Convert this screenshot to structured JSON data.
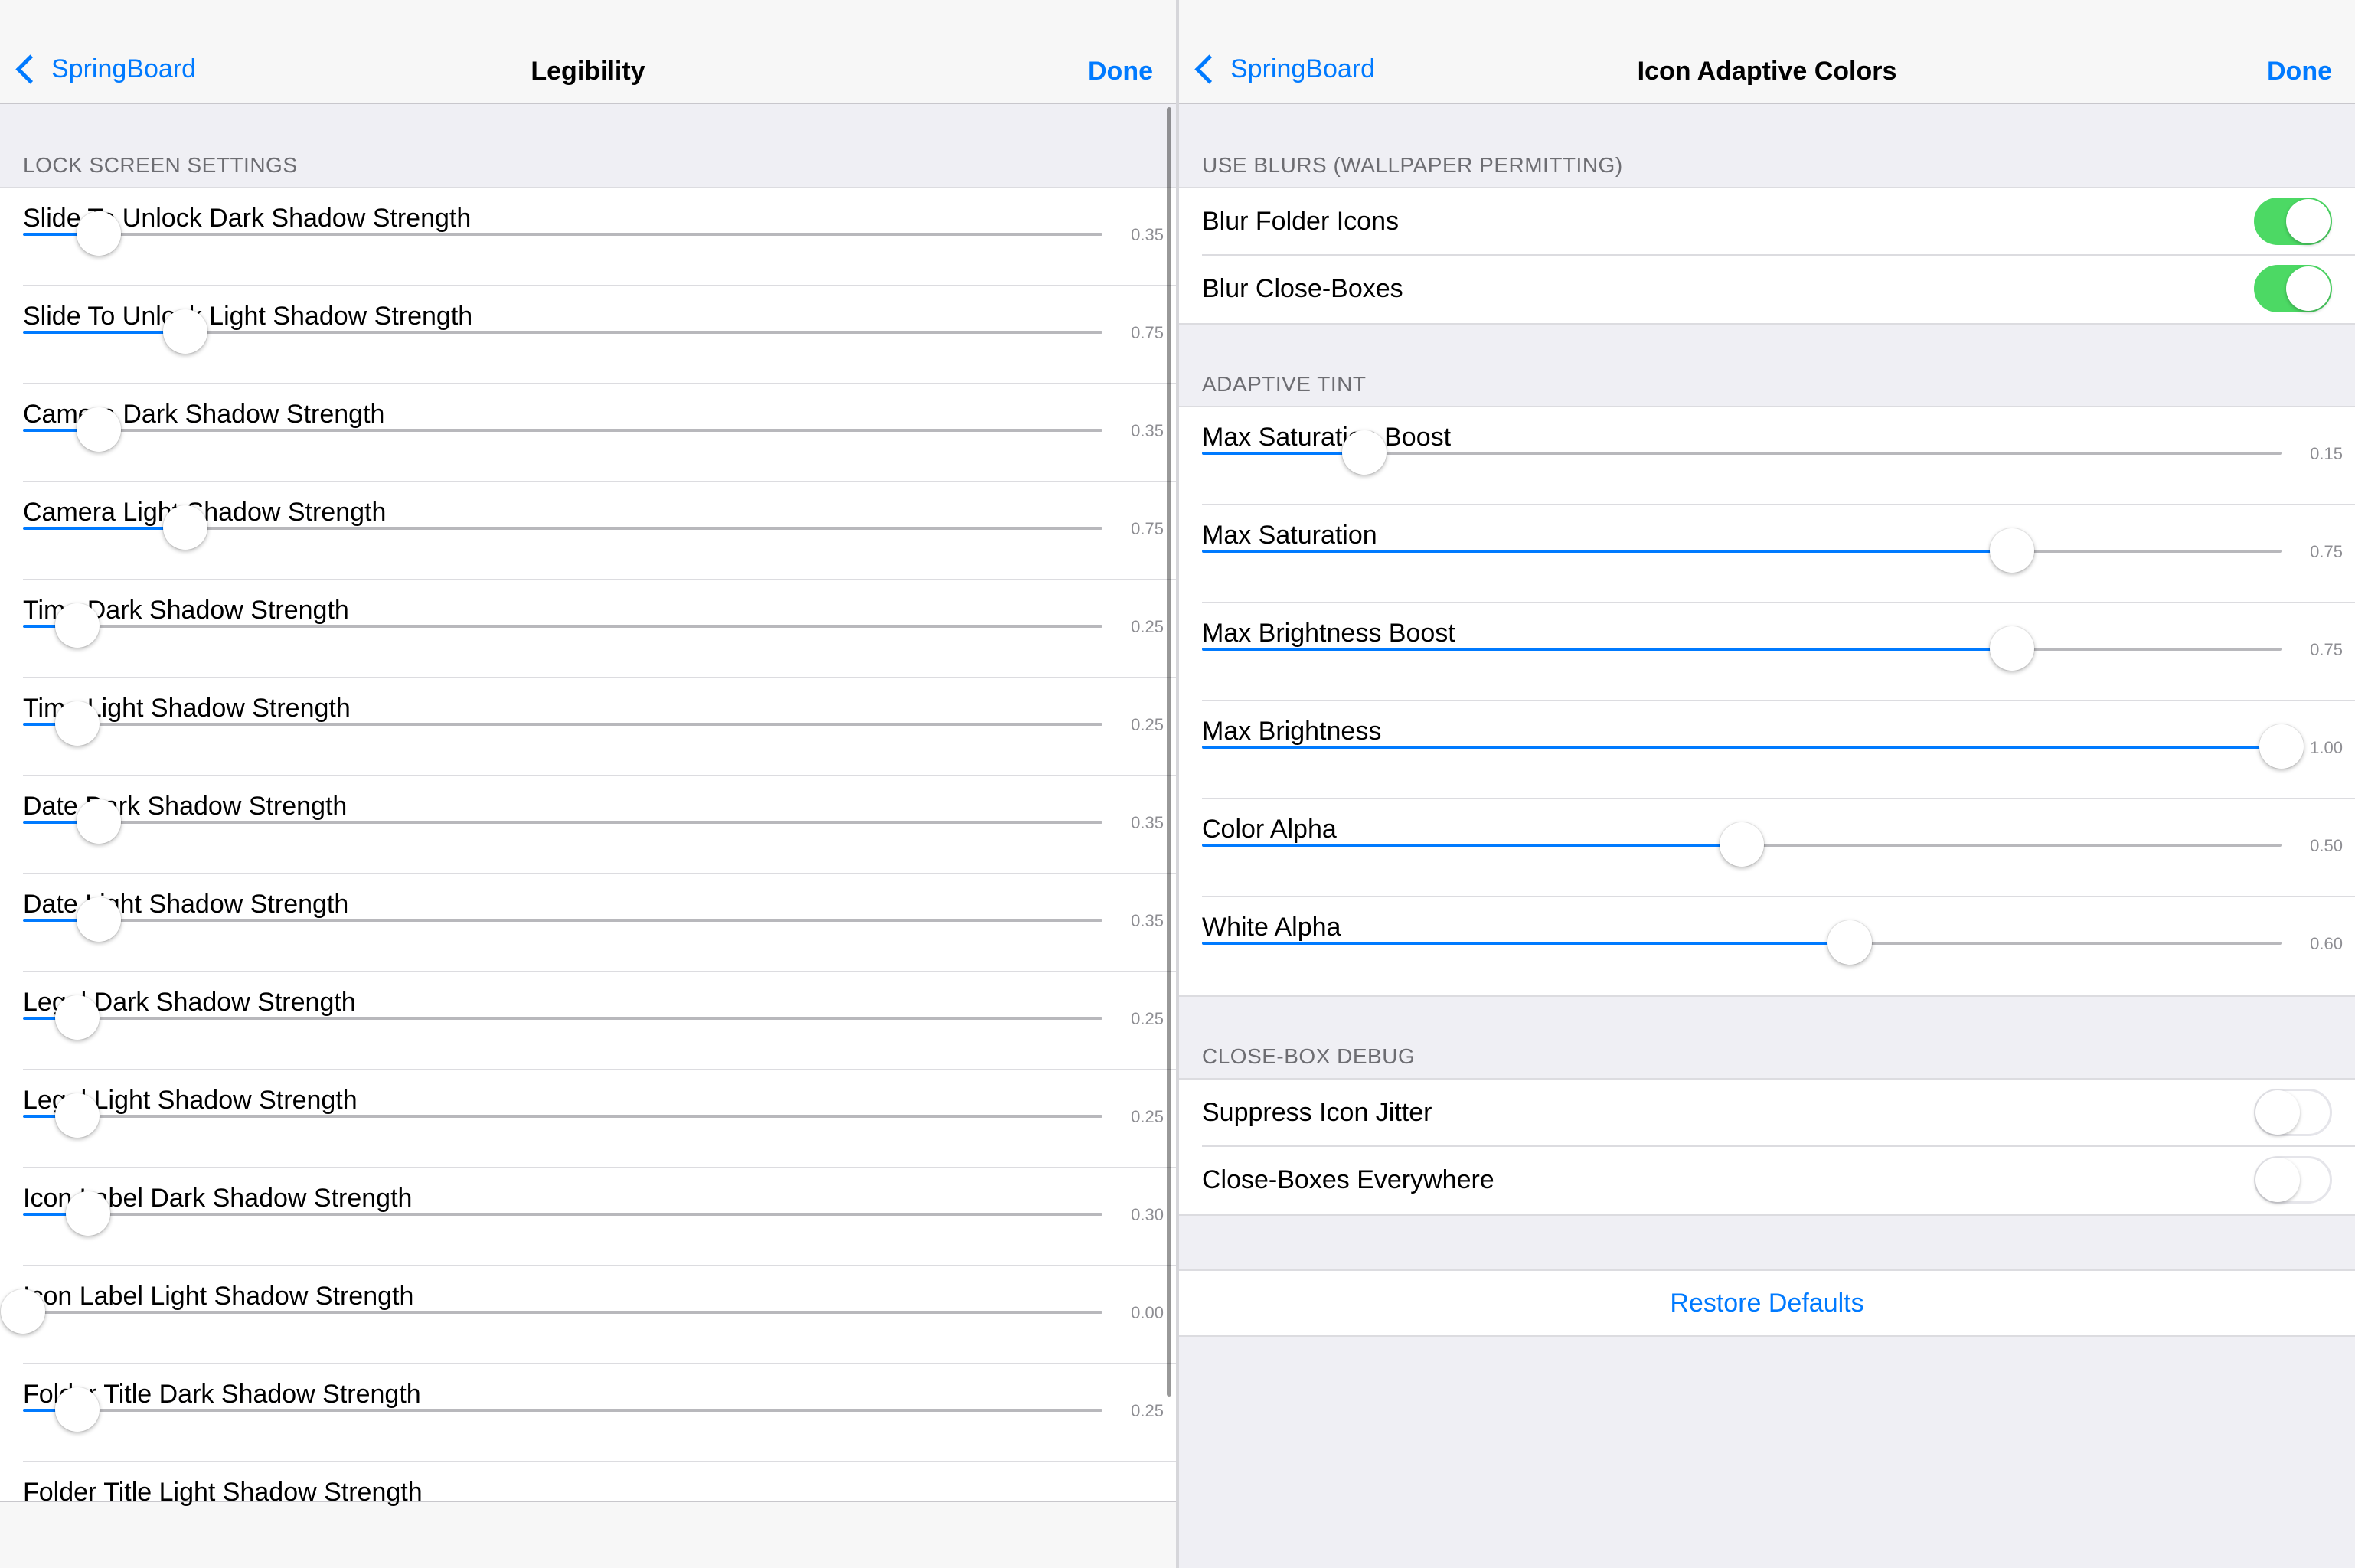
{
  "left": {
    "nav": {
      "back_label": "SpringBoard",
      "title": "Legibility",
      "done_label": "Done"
    },
    "section_header": "LOCK SCREEN SETTINGS",
    "sliders": [
      {
        "label": "Slide To Unlock Dark Shadow Strength",
        "value": 0.35,
        "value_text": "0.35"
      },
      {
        "label": "Slide To Unlock Light Shadow Strength",
        "value": 0.75,
        "value_text": "0.75"
      },
      {
        "label": "Camera Dark Shadow Strength",
        "value": 0.35,
        "value_text": "0.35"
      },
      {
        "label": "Camera Light Shadow Strength",
        "value": 0.75,
        "value_text": "0.75"
      },
      {
        "label": "Time Dark Shadow Strength",
        "value": 0.25,
        "value_text": "0.25"
      },
      {
        "label": "Time Light Shadow Strength",
        "value": 0.25,
        "value_text": "0.25"
      },
      {
        "label": "Date Dark Shadow Strength",
        "value": 0.35,
        "value_text": "0.35"
      },
      {
        "label": "Date Light Shadow Strength",
        "value": 0.35,
        "value_text": "0.35"
      },
      {
        "label": "Legal Dark Shadow Strength",
        "value": 0.25,
        "value_text": "0.25"
      },
      {
        "label": "Legal Light Shadow Strength",
        "value": 0.25,
        "value_text": "0.25"
      },
      {
        "label": "Icon Label Dark Shadow Strength",
        "value": 0.3,
        "value_text": "0.30"
      },
      {
        "label": "Icon Label Light Shadow Strength",
        "value": 0.0,
        "value_text": "0.00"
      },
      {
        "label": "Folder Title Dark Shadow Strength",
        "value": 0.25,
        "value_text": "0.25"
      },
      {
        "label": "Folder Title Light Shadow Strength",
        "value": null,
        "value_text": ""
      }
    ],
    "slider_max": 5.0
  },
  "right": {
    "nav": {
      "back_label": "SpringBoard",
      "title": "Icon Adaptive Colors",
      "done_label": "Done"
    },
    "blur_section": {
      "header": "USE BLURS (WALLPAPER PERMITTING)",
      "toggles": [
        {
          "label": "Blur Folder Icons",
          "on": true
        },
        {
          "label": "Blur Close-Boxes",
          "on": true
        }
      ]
    },
    "tint_section": {
      "header": "ADAPTIVE TINT",
      "sliders": [
        {
          "label": "Max Saturation Boost",
          "value": 0.15,
          "value_text": "0.15",
          "max": 1.0
        },
        {
          "label": "Max Saturation",
          "value": 0.75,
          "value_text": "0.75",
          "max": 1.0
        },
        {
          "label": "Max Brightness Boost",
          "value": 0.75,
          "value_text": "0.75",
          "max": 1.0
        },
        {
          "label": "Max Brightness",
          "value": 1.0,
          "value_text": "1.00",
          "max": 1.0
        },
        {
          "label": "Color Alpha",
          "value": 0.5,
          "value_text": "0.50",
          "max": 1.0
        },
        {
          "label": "White Alpha",
          "value": 0.6,
          "value_text": "0.60",
          "max": 1.0
        }
      ]
    },
    "debug_section": {
      "header": "CLOSE-BOX DEBUG",
      "toggles": [
        {
          "label": "Suppress Icon Jitter",
          "on": false
        },
        {
          "label": "Close-Boxes Everywhere",
          "on": false
        }
      ]
    },
    "restore_label": "Restore Defaults"
  },
  "colors": {
    "accent": "#007aff",
    "toggle_on": "#4cd964",
    "background": "#efeff4"
  }
}
